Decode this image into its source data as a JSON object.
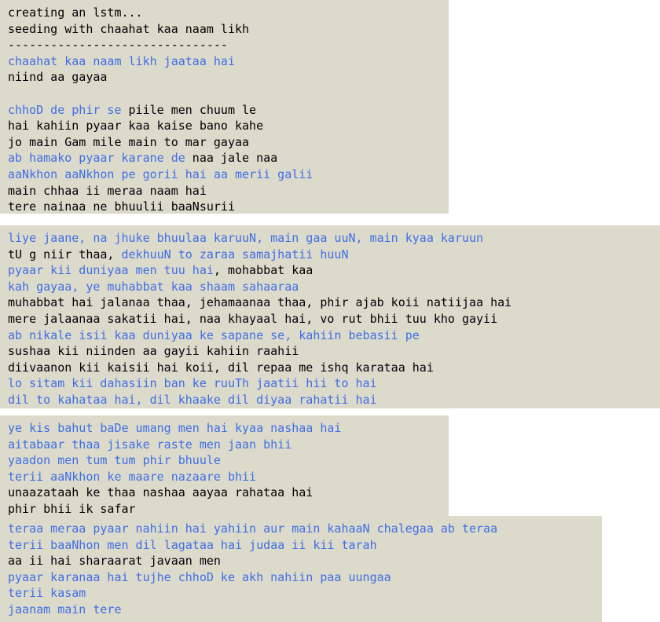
{
  "colors": {
    "panel_bg": "#dcdacb",
    "text_black": "#000000",
    "text_blue": "#3f6ee6"
  },
  "panels": [
    {
      "lines": [
        [
          {
            "t": "creating an lstm...",
            "c": "black"
          }
        ],
        [
          {
            "t": "seeding with chaahat kaa naam likh",
            "c": "black"
          }
        ],
        [
          {
            "t": "-------------------------------",
            "c": "black"
          }
        ],
        [
          {
            "t": "chaahat kaa naam likh jaataa hai",
            "c": "blue"
          }
        ],
        [
          {
            "t": "niind aa gayaa",
            "c": "black"
          }
        ],
        [],
        [
          {
            "t": "chhoD de phir se",
            "c": "blue"
          },
          {
            "t": " piile men chuum le",
            "c": "black"
          }
        ],
        [
          {
            "t": "hai kahiin pyaar kaa kaise bano kahe",
            "c": "black"
          }
        ],
        [
          {
            "t": "jo main Gam mile main to mar gayaa",
            "c": "black"
          }
        ],
        [
          {
            "t": "ab hamako pyaar karane de",
            "c": "blue"
          },
          {
            "t": " naa jale naa",
            "c": "black"
          }
        ],
        [
          {
            "t": "aaNkhon aaNkhon pe gorii hai aa merii galii",
            "c": "blue"
          }
        ],
        [
          {
            "t": "main chhaa ii meraa naam hai",
            "c": "black"
          }
        ],
        [
          {
            "t": "tere nainaa ne bhuulii baaNsurii",
            "c": "black"
          }
        ]
      ]
    },
    {
      "lines": [
        [
          {
            "t": "liye jaane, na jhuke bhuulaa karuuN, main gaa uuN, main kyaa karuun",
            "c": "blue"
          }
        ],
        [
          {
            "t": "tU g niir thaa, ",
            "c": "black"
          },
          {
            "t": "dekhuuN to zaraa samajhatii huuN",
            "c": "blue"
          }
        ],
        [
          {
            "t": "pyaar kii duniyaa men tuu hai",
            "c": "blue"
          },
          {
            "t": ", mohabbat kaa",
            "c": "black"
          }
        ],
        [
          {
            "t": "kah gayaa, ye muhabbat kaa shaam sahaaraa",
            "c": "blue"
          }
        ],
        [
          {
            "t": "muhabbat hai jalanaa thaa, jehamaanaa thaa, phir ajab koii natiijaa hai",
            "c": "black"
          }
        ],
        [
          {
            "t": "mere jalaanaa sakatii hai, naa khayaal hai, vo rut bhii tuu kho gayii",
            "c": "black"
          }
        ],
        [
          {
            "t": "ab nikale isii kaa duniyaa ke sapane se, kahiin bebasii pe",
            "c": "blue"
          }
        ],
        [
          {
            "t": "sushaa kii niinden aa gayii kahiin raahii",
            "c": "black"
          }
        ],
        [
          {
            "t": "diivaanon kii kaisii hai koii, dil repaa me ishq karataa hai",
            "c": "black"
          }
        ],
        [
          {
            "t": "lo sitam kii dahasiin ban ke ruuTh jaatii hii to hai",
            "c": "blue"
          }
        ],
        [
          {
            "t": "dil to kahataa hai, dil khaake dil diyaa rahatii hai",
            "c": "blue"
          }
        ]
      ]
    },
    {
      "lines": [
        [
          {
            "t": "ye kis bahut baDe umang men hai kyaa nashaa hai",
            "c": "blue"
          }
        ],
        [
          {
            "t": "aitabaar thaa jisake raste men jaan bhii",
            "c": "blue"
          }
        ],
        [
          {
            "t": "yaadon men tum tum phir bhuule",
            "c": "blue"
          }
        ],
        [
          {
            "t": "terii aaNkhon ke maare nazaare bhii",
            "c": "blue"
          }
        ],
        [
          {
            "t": "unaazataah ke thaa nashaa aayaa rahataa hai",
            "c": "black"
          }
        ],
        [
          {
            "t": "phir bhii ik safar",
            "c": "black"
          }
        ]
      ]
    },
    {
      "lines": [
        [
          {
            "t": "teraa meraa pyaar nahiin hai yahiin aur main kahaaN chalegaa ab teraa",
            "c": "blue"
          }
        ],
        [
          {
            "t": "terii baaNhon men dil lagataa hai judaa ii kii tarah",
            "c": "blue"
          }
        ],
        [
          {
            "t": "aa ii hai sharaarat javaan men",
            "c": "black"
          }
        ],
        [
          {
            "t": "pyaar karanaa hai tujhe chhoD ke akh nahiin paa uungaa",
            "c": "blue"
          }
        ],
        [
          {
            "t": "terii kasam",
            "c": "blue"
          }
        ],
        [
          {
            "t": "jaanam main tere",
            "c": "blue"
          }
        ]
      ]
    }
  ]
}
